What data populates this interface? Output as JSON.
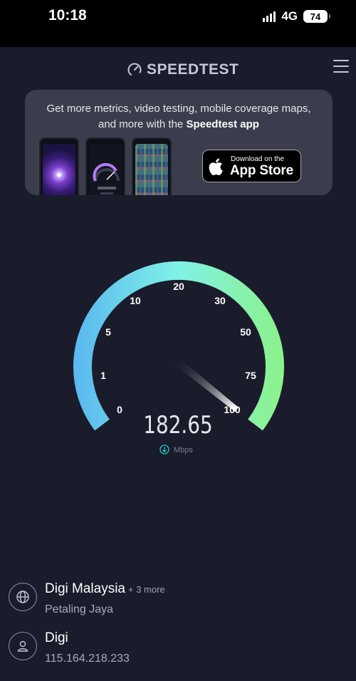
{
  "status_bar": {
    "time": "10:18",
    "network": "4G",
    "battery": "74"
  },
  "header": {
    "logo_text": "SPEEDTEST"
  },
  "promo": {
    "line1": "Get more metrics, video testing, mobile coverage maps,",
    "line2_prefix": "and more with the",
    "line2_bold": "Speedtest app",
    "appstore_small": "Download on the",
    "appstore_big": "App Store"
  },
  "gauge": {
    "scale_labels": [
      "0",
      "1",
      "5",
      "10",
      "20",
      "30",
      "50",
      "75",
      "100"
    ],
    "needle_value": "100",
    "speed_value": "182.65",
    "unit": "Mbps",
    "colors": {
      "start": "#5ab8f0",
      "mid": "#7ff2e6",
      "end": "#8cf28a"
    }
  },
  "isp": {
    "name": "Digi Malaysia",
    "more": "+ 3 more",
    "location": "Petaling Jaya"
  },
  "client": {
    "name": "Digi",
    "ip": "115.164.218.233"
  }
}
